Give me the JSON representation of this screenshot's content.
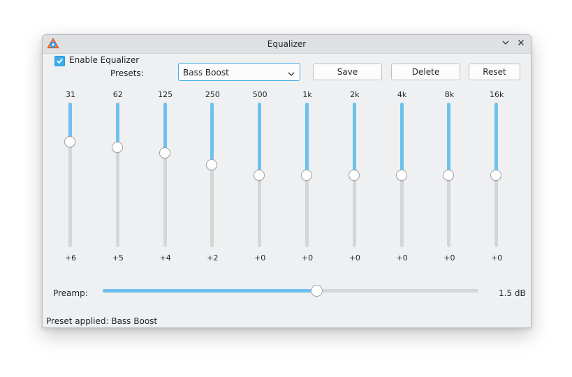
{
  "window": {
    "title": "Equalizer",
    "minimize_glyph": "⌵",
    "close_glyph": "✕"
  },
  "controls": {
    "enable_label": "Enable Equalizer",
    "enable_checked": true,
    "presets_label": "Presets:",
    "preset_selected": "Bass Boost",
    "save_label": "Save",
    "delete_label": "Delete",
    "reset_label": "Reset"
  },
  "bands": [
    {
      "freq": "31",
      "gain": "+6",
      "level": 0.73
    },
    {
      "freq": "62",
      "gain": "+5",
      "level": 0.69
    },
    {
      "freq": "125",
      "gain": "+4",
      "level": 0.65
    },
    {
      "freq": "250",
      "gain": "+2",
      "level": 0.57
    },
    {
      "freq": "500",
      "gain": "+0",
      "level": 0.5
    },
    {
      "freq": "1k",
      "gain": "+0",
      "level": 0.5
    },
    {
      "freq": "2k",
      "gain": "+0",
      "level": 0.5
    },
    {
      "freq": "4k",
      "gain": "+0",
      "level": 0.5
    },
    {
      "freq": "8k",
      "gain": "+0",
      "level": 0.5
    },
    {
      "freq": "16k",
      "gain": "+0",
      "level": 0.5
    }
  ],
  "preamp": {
    "label": "Preamp:",
    "value": "1.5 dB",
    "level": 0.57
  },
  "status": "Preset applied: Bass Boost",
  "colors": {
    "accent": "#3daee9",
    "fill": "#6fc1ed",
    "window_bg": "#eff0f1"
  },
  "icons": {
    "app": "equalizer-app-icon",
    "dropdown": "chevron-down-icon",
    "check": "check-icon"
  }
}
